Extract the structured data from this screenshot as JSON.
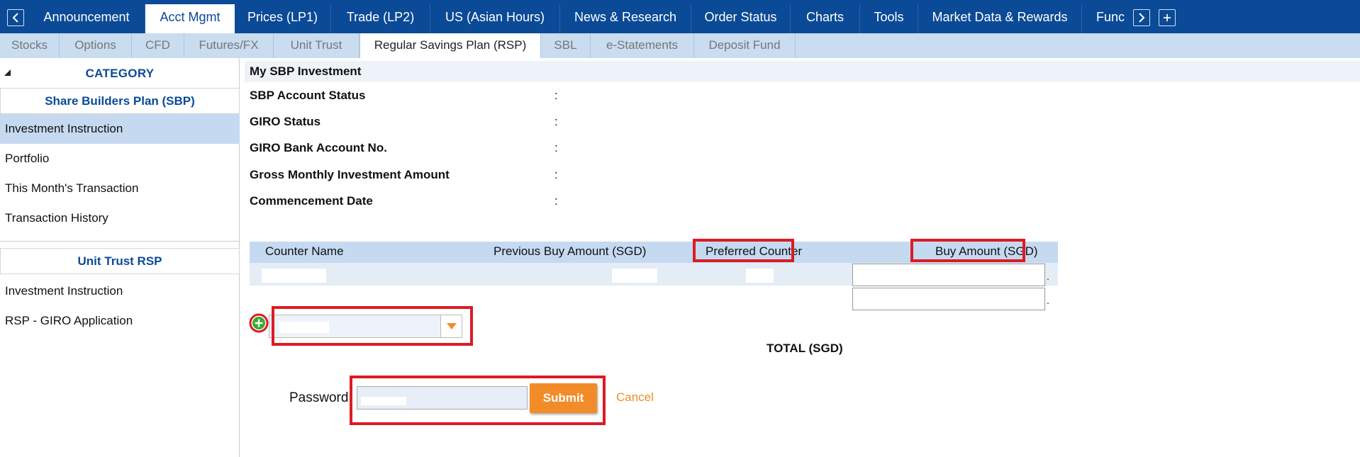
{
  "top_nav": {
    "tabs": [
      {
        "label": "Announcement"
      },
      {
        "label": "Acct Mgmt"
      },
      {
        "label": "Prices (LP1)"
      },
      {
        "label": "Trade (LP2)"
      },
      {
        "label": "US (Asian Hours)"
      },
      {
        "label": "News & Research"
      },
      {
        "label": "Order Status"
      },
      {
        "label": "Charts"
      },
      {
        "label": "Tools"
      },
      {
        "label": "Market Data & Rewards"
      },
      {
        "label": "Func"
      }
    ],
    "active": "Acct Mgmt"
  },
  "sub_nav": {
    "tabs": [
      {
        "label": "Stocks"
      },
      {
        "label": "Options"
      },
      {
        "label": "CFD"
      },
      {
        "label": "Futures/FX"
      },
      {
        "label": "Unit Trust"
      },
      {
        "label": "Regular Savings Plan (RSP)"
      },
      {
        "label": "SBL"
      },
      {
        "label": "e-Statements"
      },
      {
        "label": "Deposit Fund"
      }
    ],
    "active": "Regular Savings Plan (RSP)"
  },
  "sidebar": {
    "category_label": "CATEGORY",
    "groups": [
      {
        "title": "Share Builders Plan (SBP)",
        "items": [
          {
            "label": "Investment Instruction"
          },
          {
            "label": "Portfolio"
          },
          {
            "label": "This Month's Transaction"
          },
          {
            "label": "Transaction History"
          }
        ]
      },
      {
        "title": "Unit Trust RSP",
        "items": [
          {
            "label": "Investment Instruction"
          },
          {
            "label": "RSP - GIRO Application"
          }
        ]
      }
    ],
    "active_item": "Investment Instruction"
  },
  "main": {
    "section_title": "My SBP Investment",
    "info_rows": [
      {
        "label": "SBP Account Status",
        "sep": ":"
      },
      {
        "label": "GIRO Status",
        "sep": ":"
      },
      {
        "label": "GIRO Bank Account No.",
        "sep": ":"
      },
      {
        "label": "Gross Monthly Investment Amount",
        "sep": ":"
      },
      {
        "label": "Commencement Date",
        "sep": ":"
      }
    ],
    "table": {
      "headers": {
        "counter_name": "Counter Name",
        "previous_buy_amount": "Previous Buy Amount (SGD)",
        "preferred_counter": "Preferred Counter",
        "buy_amount": "Buy Amount (SGD)"
      },
      "decimal_sep": "."
    },
    "total_label": "TOTAL (SGD)",
    "password_label": "Password",
    "submit_label": "Submit",
    "cancel_label": "Cancel"
  },
  "colors": {
    "nav_blue": "#0b4a96",
    "subnav_blue": "#c9dcf0",
    "accent_orange": "#f28c28",
    "highlight_red": "#dc1b23",
    "add_green": "#3aa935"
  }
}
